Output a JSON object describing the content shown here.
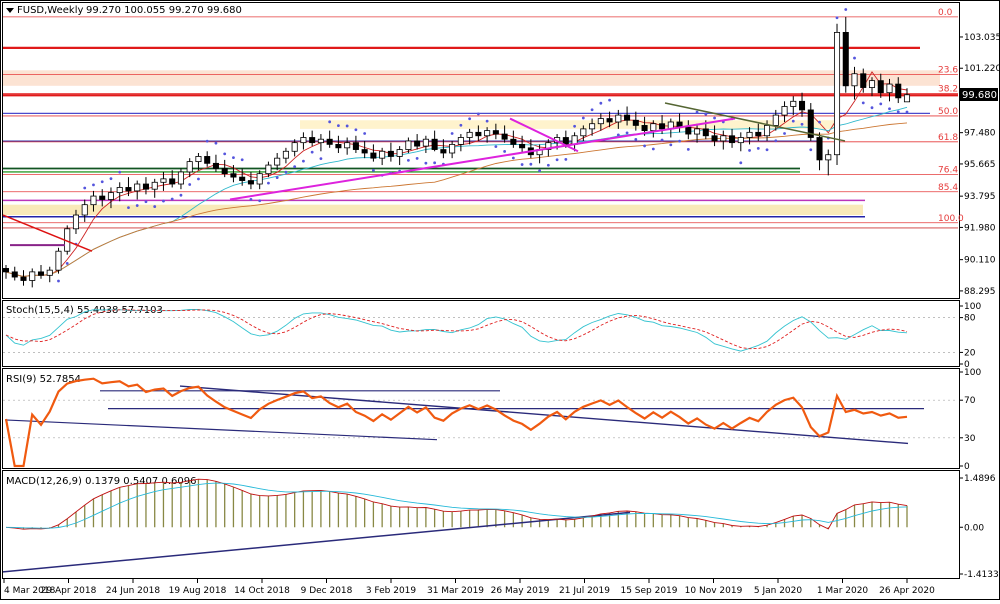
{
  "header": {
    "symbol": "FUSD,Weekly",
    "ohlc": "99.270 100.055 99.270 99.680"
  },
  "current_price": "99.680",
  "chart_data": [
    {
      "type": "candlestick",
      "ylim": [
        88.0,
        104.6
      ],
      "y_ticks": [
        "103.035",
        "101.220",
        "99.550",
        "97.480",
        "95.665",
        "93.795",
        "91.980",
        "90.110",
        "88.295"
      ],
      "x_ticks": [
        "4 Mar 2018",
        "29 Apr 2018",
        "24 Jun 2018",
        "19 Aug 2018",
        "14 Oct 2018",
        "9 Dec 2018",
        "3 Feb 2019",
        "31 Mar 2019",
        "26 May 2019",
        "21 Jul 2019",
        "15 Sep 2019",
        "10 Nov 2019",
        "5 Jan 2020",
        "1 Mar 2020",
        "26 Apr 2020"
      ],
      "fib_levels": [
        {
          "label": "0.0",
          "value": 104.2
        },
        {
          "label": "23.6",
          "value": 100.85
        },
        {
          "label": "38.2",
          "value": 99.75
        },
        {
          "label": "50.0",
          "value": 98.45
        },
        {
          "label": "61.8",
          "value": 96.95
        },
        {
          "label": "76.4",
          "value": 95.05
        },
        {
          "label": "85.4",
          "value": 94.05
        },
        {
          "label": "100.0",
          "value": 92.25
        }
      ],
      "candles": [
        [
          89.6,
          89.8,
          89.0,
          89.4
        ],
        [
          89.4,
          89.7,
          88.9,
          89.1
        ],
        [
          89.1,
          89.5,
          88.6,
          88.9
        ],
        [
          88.9,
          89.6,
          88.5,
          89.4
        ],
        [
          89.4,
          89.8,
          89.0,
          89.2
        ],
        [
          89.2,
          89.7,
          88.8,
          89.5
        ],
        [
          89.5,
          90.8,
          89.3,
          90.6
        ],
        [
          90.6,
          92.1,
          90.4,
          91.9
        ],
        [
          91.9,
          93.0,
          91.6,
          92.7
        ],
        [
          92.7,
          93.6,
          92.3,
          93.3
        ],
        [
          93.3,
          94.1,
          92.9,
          93.8
        ],
        [
          93.8,
          94.2,
          93.2,
          93.6
        ],
        [
          93.6,
          94.3,
          93.1,
          94.0
        ],
        [
          94.0,
          94.6,
          93.5,
          94.3
        ],
        [
          94.3,
          94.9,
          93.8,
          94.1
        ],
        [
          94.1,
          94.7,
          93.6,
          94.5
        ],
        [
          94.5,
          94.9,
          93.9,
          94.2
        ],
        [
          94.2,
          94.8,
          93.7,
          94.6
        ],
        [
          94.6,
          95.2,
          94.1,
          94.8
        ],
        [
          94.8,
          95.3,
          94.3,
          94.5
        ],
        [
          94.5,
          95.4,
          94.2,
          95.2
        ],
        [
          95.2,
          96.0,
          94.9,
          95.8
        ],
        [
          95.8,
          96.3,
          95.3,
          96.1
        ],
        [
          96.1,
          96.4,
          95.5,
          95.7
        ],
        [
          95.7,
          96.2,
          95.2,
          95.4
        ],
        [
          95.4,
          95.9,
          94.9,
          95.1
        ],
        [
          95.1,
          95.6,
          94.6,
          94.9
        ],
        [
          94.9,
          95.4,
          94.4,
          94.7
        ],
        [
          94.7,
          95.2,
          94.2,
          94.5
        ],
        [
          94.5,
          95.3,
          94.2,
          95.1
        ],
        [
          95.1,
          95.8,
          94.9,
          95.6
        ],
        [
          95.6,
          96.3,
          95.3,
          96.0
        ],
        [
          96.0,
          96.6,
          95.7,
          96.4
        ],
        [
          96.4,
          97.1,
          96.1,
          96.9
        ],
        [
          96.9,
          97.5,
          96.5,
          97.2
        ],
        [
          97.2,
          97.6,
          96.7,
          96.9
        ],
        [
          96.9,
          97.4,
          96.4,
          97.1
        ],
        [
          97.1,
          97.6,
          96.6,
          96.8
        ],
        [
          96.8,
          97.3,
          96.3,
          96.6
        ],
        [
          96.6,
          97.2,
          96.2,
          96.9
        ],
        [
          96.9,
          97.3,
          96.3,
          96.5
        ],
        [
          96.5,
          97.0,
          96.0,
          96.3
        ],
        [
          96.3,
          96.8,
          95.8,
          96.0
        ],
        [
          96.0,
          96.6,
          95.6,
          96.4
        ],
        [
          96.4,
          96.9,
          95.8,
          96.1
        ],
        [
          96.1,
          96.7,
          95.6,
          96.5
        ],
        [
          96.5,
          97.2,
          96.3,
          97.0
        ],
        [
          97.0,
          97.4,
          96.5,
          96.7
        ],
        [
          96.7,
          97.3,
          96.3,
          97.1
        ],
        [
          97.1,
          97.6,
          96.4,
          96.5
        ],
        [
          96.5,
          97.1,
          96.0,
          96.3
        ],
        [
          96.3,
          97.0,
          96.0,
          96.8
        ],
        [
          96.8,
          97.4,
          96.4,
          97.2
        ],
        [
          97.2,
          97.7,
          96.8,
          97.5
        ],
        [
          97.5,
          97.9,
          97.0,
          97.3
        ],
        [
          97.3,
          97.8,
          96.9,
          97.6
        ],
        [
          97.6,
          98.0,
          97.1,
          97.4
        ],
        [
          97.4,
          97.9,
          96.9,
          97.1
        ],
        [
          97.1,
          97.6,
          96.6,
          96.8
        ],
        [
          96.8,
          97.3,
          96.3,
          96.6
        ],
        [
          96.6,
          97.1,
          96.0,
          96.2
        ],
        [
          96.2,
          96.8,
          95.7,
          96.5
        ],
        [
          96.5,
          97.1,
          96.1,
          96.9
        ],
        [
          96.9,
          97.4,
          96.5,
          97.2
        ],
        [
          97.2,
          97.6,
          96.6,
          96.8
        ],
        [
          96.8,
          97.5,
          96.4,
          97.3
        ],
        [
          97.3,
          97.9,
          97.0,
          97.7
        ],
        [
          97.7,
          98.3,
          97.3,
          98.0
        ],
        [
          98.0,
          98.6,
          97.6,
          98.3
        ],
        [
          98.3,
          98.7,
          97.8,
          98.1
        ],
        [
          98.1,
          98.8,
          97.7,
          98.5
        ],
        [
          98.5,
          99.0,
          97.9,
          98.2
        ],
        [
          98.2,
          98.7,
          97.6,
          97.9
        ],
        [
          97.9,
          98.4,
          97.3,
          97.6
        ],
        [
          97.6,
          98.2,
          97.2,
          98.0
        ],
        [
          98.0,
          98.5,
          97.4,
          97.7
        ],
        [
          97.7,
          98.3,
          97.2,
          98.1
        ],
        [
          98.1,
          98.6,
          97.5,
          97.8
        ],
        [
          97.8,
          98.2,
          97.1,
          97.4
        ],
        [
          97.4,
          98.0,
          96.9,
          97.7
        ],
        [
          97.7,
          98.2,
          97.1,
          97.3
        ],
        [
          97.3,
          97.9,
          96.7,
          97.0
        ],
        [
          97.0,
          97.6,
          96.5,
          97.3
        ],
        [
          97.3,
          97.7,
          96.6,
          96.9
        ],
        [
          96.9,
          97.5,
          96.4,
          97.2
        ],
        [
          97.2,
          97.8,
          96.8,
          97.5
        ],
        [
          97.5,
          98.0,
          97.0,
          97.3
        ],
        [
          97.3,
          98.2,
          97.0,
          97.9
        ],
        [
          97.9,
          98.8,
          97.6,
          98.5
        ],
        [
          98.5,
          99.3,
          98.1,
          99.0
        ],
        [
          99.0,
          99.6,
          98.5,
          99.3
        ],
        [
          99.3,
          99.8,
          98.4,
          98.8
        ],
        [
          98.8,
          99.2,
          97.0,
          97.2
        ],
        [
          97.2,
          97.5,
          95.3,
          95.9
        ],
        [
          95.9,
          96.5,
          95.0,
          96.2
        ],
        [
          96.2,
          103.8,
          95.6,
          103.3
        ],
        [
          103.3,
          104.2,
          99.8,
          100.2
        ],
        [
          100.2,
          101.3,
          99.4,
          100.9
        ],
        [
          100.9,
          101.2,
          99.8,
          100.1
        ],
        [
          100.1,
          100.7,
          99.6,
          100.5
        ],
        [
          100.5,
          100.9,
          99.5,
          99.8
        ],
        [
          99.8,
          100.6,
          99.3,
          100.3
        ],
        [
          100.3,
          100.7,
          99.2,
          99.5
        ],
        [
          99.27,
          100.055,
          99.27,
          99.68
        ]
      ]
    },
    {
      "type": "line",
      "title": "Stoch(15,5,4) 55.4938 57.7103",
      "ylim": [
        0,
        100
      ],
      "y_ticks": [
        "100",
        "80",
        "20",
        "0"
      ]
    },
    {
      "type": "line",
      "title": "RSI(9) 52.7854",
      "ylim": [
        0,
        100
      ],
      "y_ticks": [
        "100",
        "70",
        "30",
        "0"
      ]
    },
    {
      "type": "bar",
      "title": "MACD(12,26,9) 0.1379 0.5407 0.6096",
      "ylim": [
        -1.4133,
        1.4896
      ],
      "y_ticks": [
        "1.4896",
        "0.00",
        "-1.4133"
      ]
    }
  ],
  "colors": {
    "up": "#000000",
    "down": "#000000",
    "fib": "#e53b3b",
    "trend": "#dd22dd",
    "rsi": "#f05a10",
    "stoch_main": "#34c3d0",
    "stoch_signal": "#e02020",
    "macd_hist": "#888844",
    "macd_line": "#c01010",
    "macd_signal": "#26b9d9",
    "navy": "#2a2a7a"
  }
}
